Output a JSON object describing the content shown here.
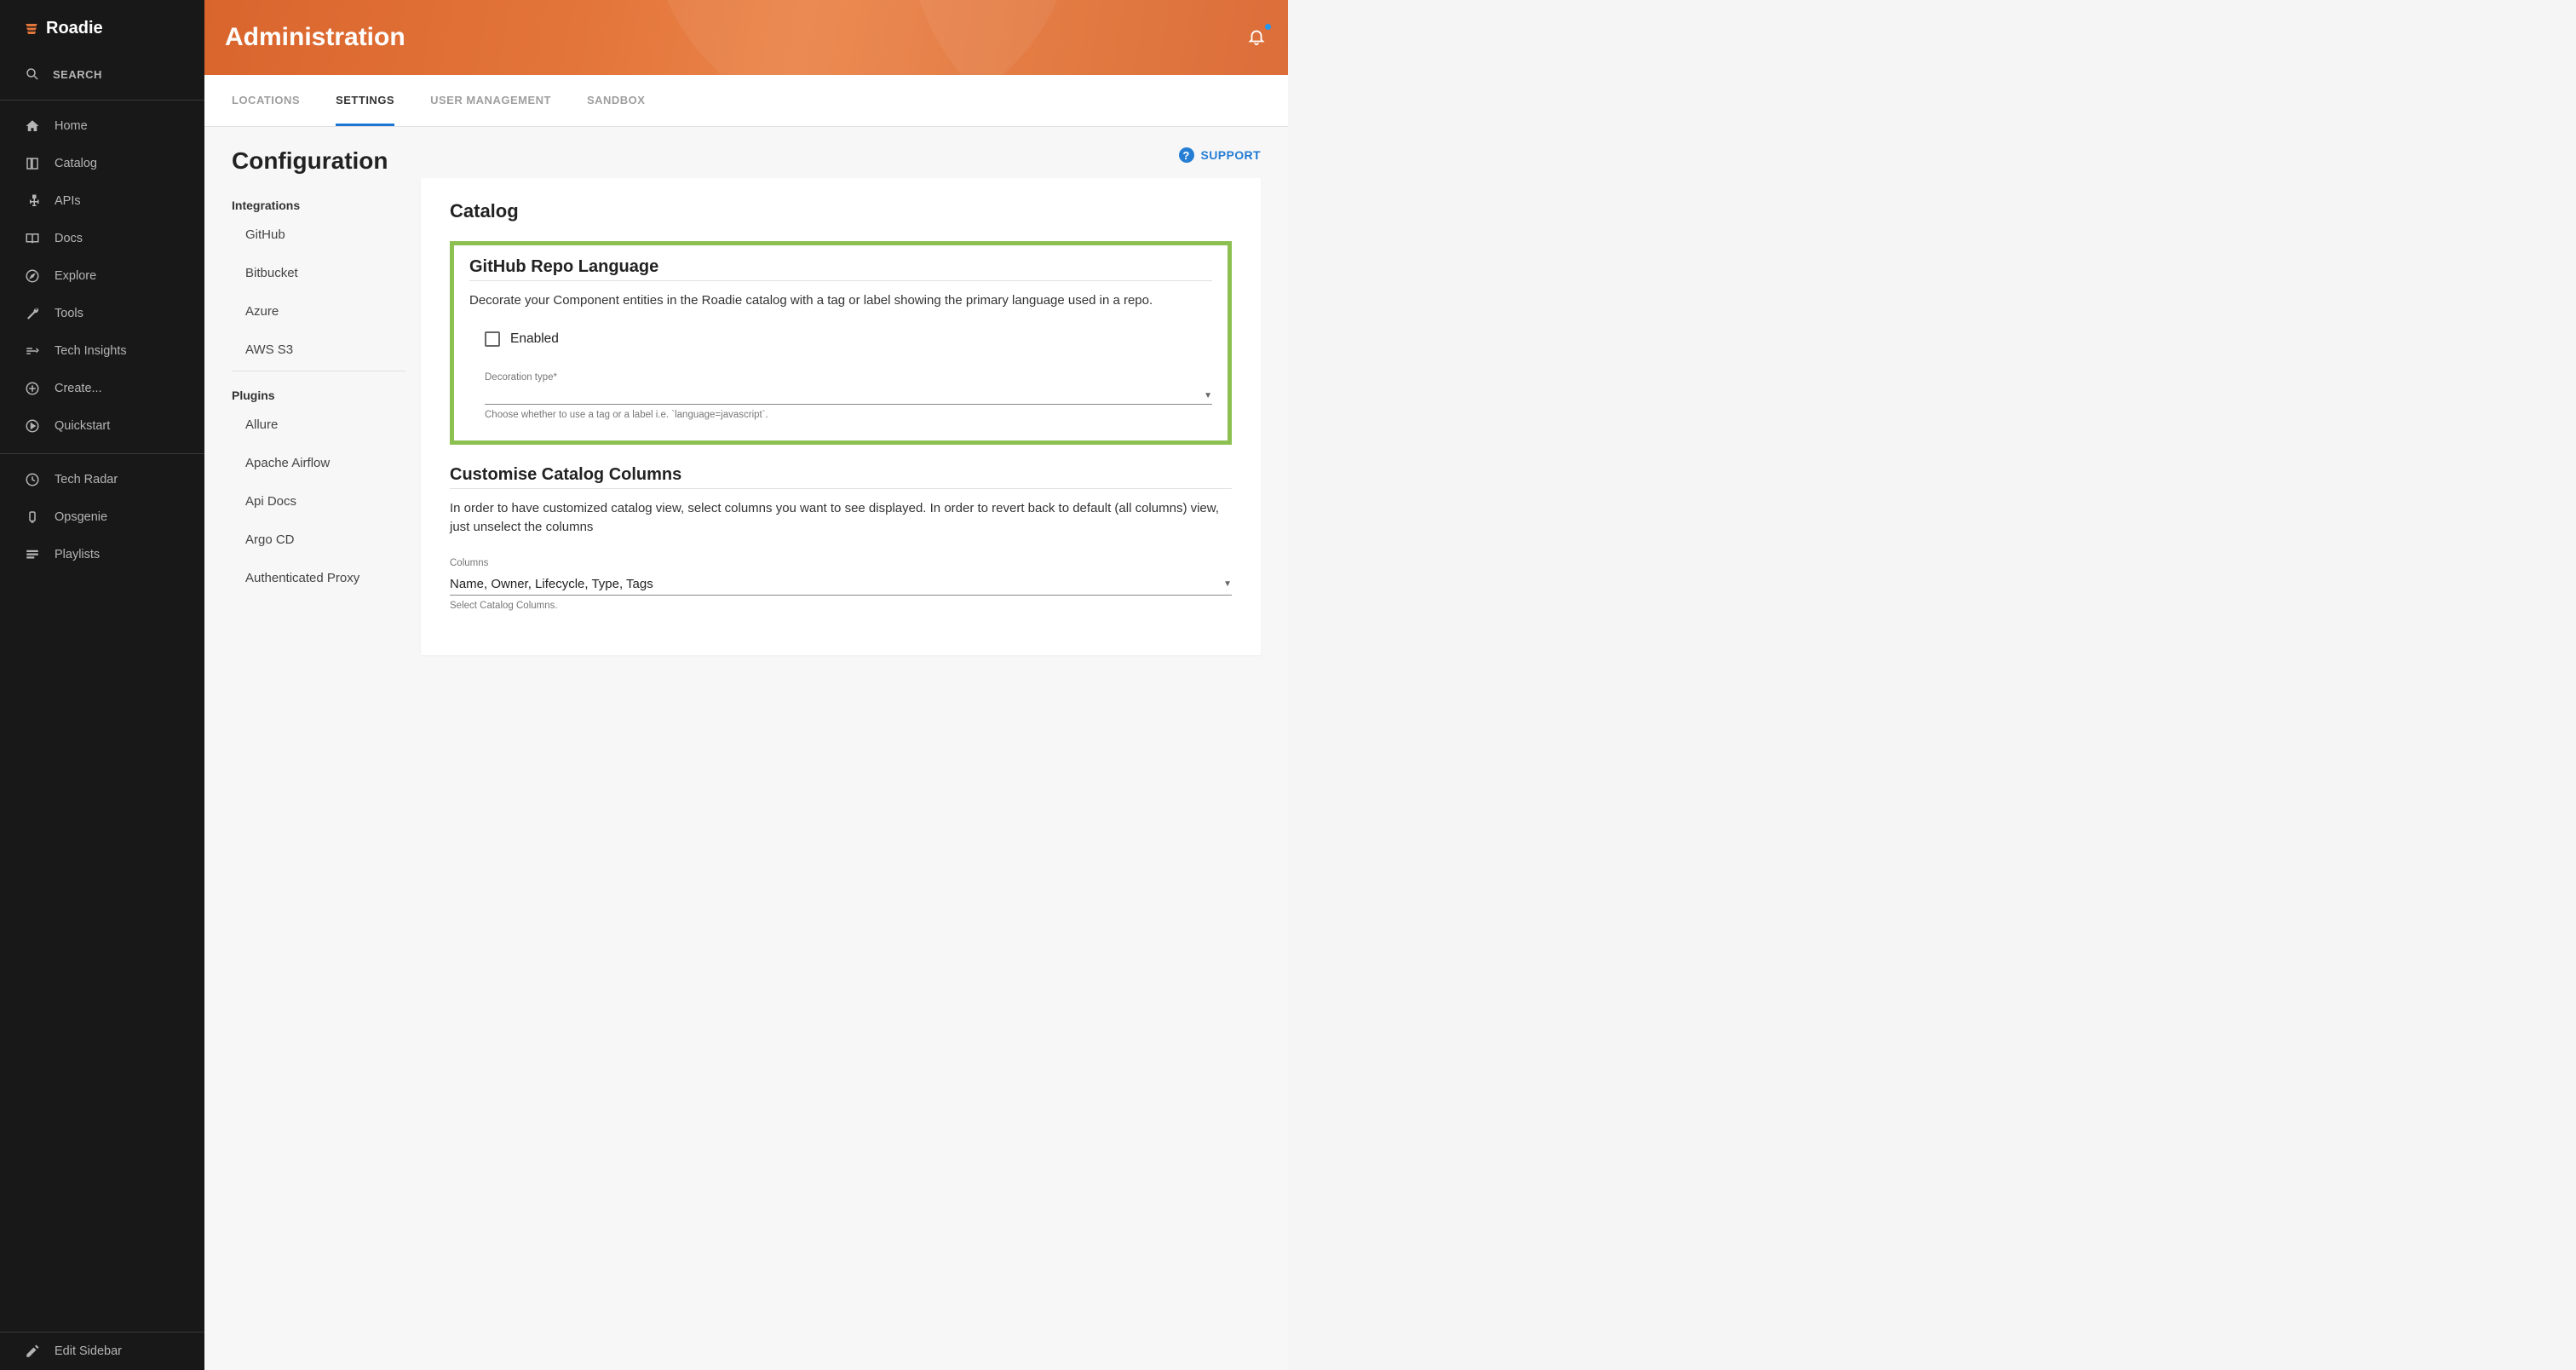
{
  "brand": {
    "name": "Roadie"
  },
  "sidebar": {
    "search": "SEARCH",
    "nav": [
      {
        "label": "Home"
      },
      {
        "label": "Catalog"
      },
      {
        "label": "APIs"
      },
      {
        "label": "Docs"
      },
      {
        "label": "Explore"
      },
      {
        "label": "Tools"
      },
      {
        "label": "Tech Insights"
      },
      {
        "label": "Create..."
      },
      {
        "label": "Quickstart"
      }
    ],
    "bottom": [
      {
        "label": "Tech Radar"
      },
      {
        "label": "Opsgenie"
      },
      {
        "label": "Playlists"
      }
    ],
    "footer": {
      "label": "Edit Sidebar"
    }
  },
  "header": {
    "title": "Administration"
  },
  "tabs": [
    {
      "label": "LOCATIONS",
      "active": false
    },
    {
      "label": "SETTINGS",
      "active": true
    },
    {
      "label": "USER MANAGEMENT",
      "active": false
    },
    {
      "label": "SANDBOX",
      "active": false
    }
  ],
  "page": {
    "title": "Configuration",
    "support": "SUPPORT"
  },
  "settings_nav": {
    "groups": [
      {
        "title": "Integrations",
        "items": [
          "GitHub",
          "Bitbucket",
          "Azure",
          "AWS S3"
        ]
      },
      {
        "title": "Plugins",
        "items": [
          "Allure",
          "Apache Airflow",
          "Api Docs",
          "Argo CD",
          "Authenticated Proxy"
        ]
      }
    ]
  },
  "panel": {
    "title": "Catalog",
    "github_section": {
      "title": "GitHub Repo Language",
      "desc": "Decorate your Component entities in the Roadie catalog with a tag or label showing the primary language used in a repo.",
      "checkbox_label": "Enabled",
      "field_label": "Decoration type*",
      "field_helper": "Choose whether to use a tag or a label i.e. `language=javascript`."
    },
    "columns_section": {
      "title": "Customise Catalog Columns",
      "desc": "In order to have customized catalog view, select columns you want to see displayed. In order to revert back to default (all columns) view, just unselect the columns",
      "field_label": "Columns",
      "field_value": "Name, Owner, Lifecycle, Type, Tags",
      "field_helper": "Select Catalog Columns."
    }
  }
}
